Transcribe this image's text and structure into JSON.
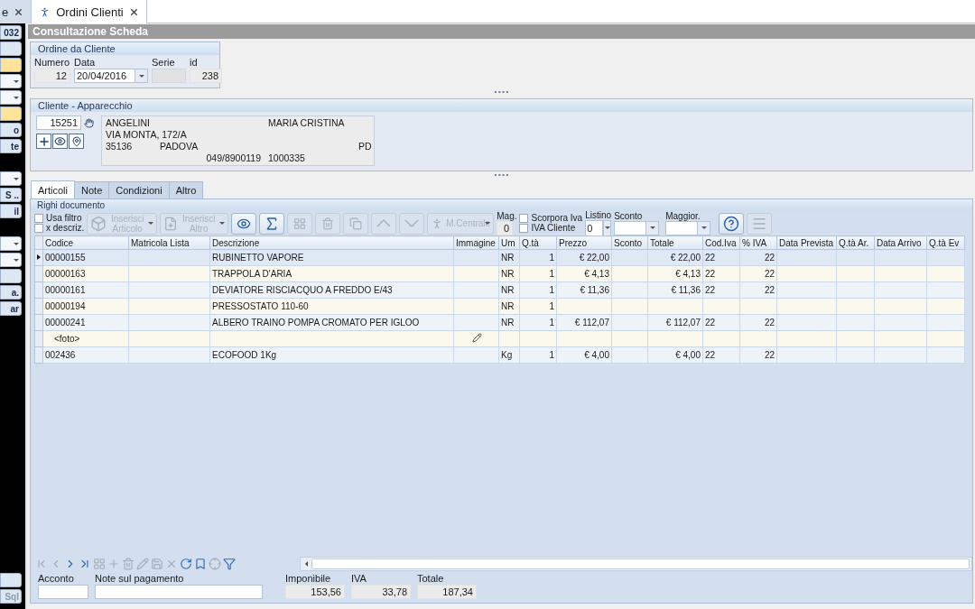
{
  "doc_tabs": [
    {
      "label": "e",
      "selected": false
    },
    {
      "label": "Ordini Clienti",
      "selected": true
    }
  ],
  "sidebar": {
    "items": [
      {
        "kind": "field",
        "label": "032"
      },
      {
        "kind": "button"
      },
      {
        "kind": "highlight"
      },
      {
        "kind": "combo"
      },
      {
        "kind": "combo"
      },
      {
        "kind": "highlight"
      },
      {
        "kind": "button",
        "label": "o"
      },
      {
        "kind": "button",
        "label": "te"
      },
      {
        "kind": "gap"
      },
      {
        "kind": "combo"
      },
      {
        "kind": "button",
        "label": "S .."
      },
      {
        "kind": "button",
        "label": "il"
      },
      {
        "kind": "gap"
      },
      {
        "kind": "combo"
      },
      {
        "kind": "combo"
      },
      {
        "kind": "button"
      },
      {
        "kind": "button",
        "label": "a."
      },
      {
        "kind": "button",
        "label": "ar"
      }
    ],
    "bottom_items": [
      {
        "kind": "button"
      },
      {
        "kind": "button",
        "label": "Sql",
        "disabled": true
      }
    ]
  },
  "title": "Consultazione Scheda",
  "order": {
    "title": "Ordine da Cliente",
    "numero_label": "Numero",
    "numero": "12",
    "data_label": "Data",
    "data": "20/04/2016",
    "serie_label": "Serie",
    "id_label": "id",
    "id": "238"
  },
  "client": {
    "title": "Cliente - Apparecchio",
    "code": "15251",
    "surname": "ANGELINI",
    "name": "MARIA CRISTINA",
    "address": "VIA MONTA, 172/A",
    "zip": "35136",
    "city": "PADOVA",
    "province": "PD",
    "phone": "049/8900119",
    "tax_code": "1000335"
  },
  "tabs": [
    {
      "label": "Articoli",
      "selected": true
    },
    {
      "label": "Note",
      "selected": false
    },
    {
      "label": "Condizioni",
      "selected": false
    },
    {
      "label": "Altro",
      "selected": false
    }
  ],
  "panel_title": "Righi documento",
  "toolbar": {
    "filter_checks": [
      {
        "label": "Usa filtro",
        "checked": false
      },
      {
        "label": "x descriz.",
        "checked": false
      }
    ],
    "buttons": [
      {
        "kind": "box",
        "label": "Inserisci Articolo",
        "disabled": true,
        "dropdown": true
      },
      {
        "kind": "doc",
        "label": "Inserisci Altro",
        "disabled": true,
        "dropdown": true
      },
      {
        "kind": "eye",
        "disabled": false
      },
      {
        "kind": "sigma",
        "disabled": false
      },
      {
        "kind": "grid",
        "disabled": true
      },
      {
        "kind": "trash",
        "disabled": true
      },
      {
        "kind": "copy",
        "disabled": true
      },
      {
        "kind": "up",
        "disabled": true
      },
      {
        "kind": "down",
        "disabled": true
      },
      {
        "kind": "walk",
        "label": "M.Centrale",
        "disabled": true,
        "dropdown": true
      }
    ],
    "mag_label": "Mag.",
    "mag": "0",
    "iva_checks": [
      {
        "label": "Scorpora Iva",
        "checked": false
      },
      {
        "label": "IVA Cliente",
        "checked": false
      }
    ],
    "listino_label": "Listino",
    "listino": "0",
    "sconto_label": "Sconto",
    "maggior_label": "Maggior.",
    "end_buttons": [
      {
        "kind": "help",
        "disabled": false
      },
      {
        "kind": "menu",
        "disabled": true
      }
    ]
  },
  "table": {
    "columns": [
      "Codice",
      "Matricola Lista",
      "Descrizione",
      "Immagine",
      "Um",
      "Q.tà",
      "Prezzo",
      "Sconto",
      "Totale",
      "Cod.Iva",
      "% IVA",
      "Data Prevista",
      "Q.tà Ar.",
      "Data Arrivo",
      "Q.tà Ev"
    ],
    "rows": [
      {
        "kind": "item",
        "selected": true,
        "cells": [
          "00000155",
          "",
          "RUBINETTO VAPORE",
          "",
          "NR",
          "1",
          "€ 22,00",
          "",
          "€ 22,00",
          "22",
          "22",
          "",
          "",
          "",
          ""
        ]
      },
      {
        "kind": "item",
        "selected": false,
        "cells": [
          "00000163",
          "",
          "TRAPPOLA D'ARIA",
          "",
          "NR",
          "1",
          "€ 4,13",
          "",
          "€ 4,13",
          "22",
          "22",
          "",
          "",
          "",
          ""
        ]
      },
      {
        "kind": "item",
        "selected": false,
        "cells": [
          "00000161",
          "",
          "DEVIATORE RISCIACQUO A FREDDO E/43",
          "",
          "NR",
          "1",
          "€ 11,36",
          "",
          "€ 11,36",
          "22",
          "22",
          "",
          "",
          "",
          ""
        ]
      },
      {
        "kind": "item",
        "selected": false,
        "cells": [
          "00000194",
          "",
          "PRESSOSTATO 110-60",
          "",
          "NR",
          "1",
          "",
          "",
          "",
          "",
          "",
          "",
          "",
          "",
          ""
        ]
      },
      {
        "kind": "item",
        "selected": false,
        "cells": [
          "00000241",
          "",
          "ALBERO TRAINO POMPA CROMATO PER IGLOO",
          "",
          "NR",
          "1",
          "€ 112,07",
          "",
          "€ 112,07",
          "22",
          "22",
          "",
          "",
          "",
          ""
        ]
      },
      {
        "kind": "photo",
        "selected": false,
        "cells": [
          "<foto>",
          "",
          "",
          "",
          "",
          "",
          "",
          "",
          "",
          "",
          "",
          "",
          "",
          "",
          ""
        ]
      },
      {
        "kind": "item",
        "selected": false,
        "cells": [
          "002436",
          "",
          "ECOFOOD 1Kg",
          "",
          "Kg",
          "1",
          "€ 4,00",
          "",
          "€ 4,00",
          "22",
          "22",
          "",
          "",
          "",
          ""
        ]
      }
    ]
  },
  "nav": [
    {
      "kind": "first",
      "disabled": true
    },
    {
      "kind": "prev",
      "disabled": true
    },
    {
      "kind": "next",
      "disabled": false
    },
    {
      "kind": "last",
      "disabled": false
    },
    {
      "kind": "grid",
      "disabled": true
    },
    {
      "kind": "add",
      "disabled": true
    },
    {
      "kind": "delete",
      "disabled": true
    },
    {
      "kind": "edit",
      "disabled": true
    },
    {
      "kind": "save",
      "disabled": true
    },
    {
      "kind": "cancel",
      "disabled": true
    },
    {
      "kind": "refresh",
      "disabled": false
    },
    {
      "kind": "bookmark",
      "disabled": false
    },
    {
      "kind": "target",
      "disabled": true
    },
    {
      "kind": "filter",
      "disabled": false
    }
  ],
  "footer": {
    "acconto_label": "Acconto",
    "note_label": "Note sul pagamento",
    "imponibile_label": "Imponibile",
    "imponibile": "153,56",
    "iva_label": "IVA",
    "iva": "33,78",
    "totale_label": "Totale",
    "totale": "187,34"
  }
}
